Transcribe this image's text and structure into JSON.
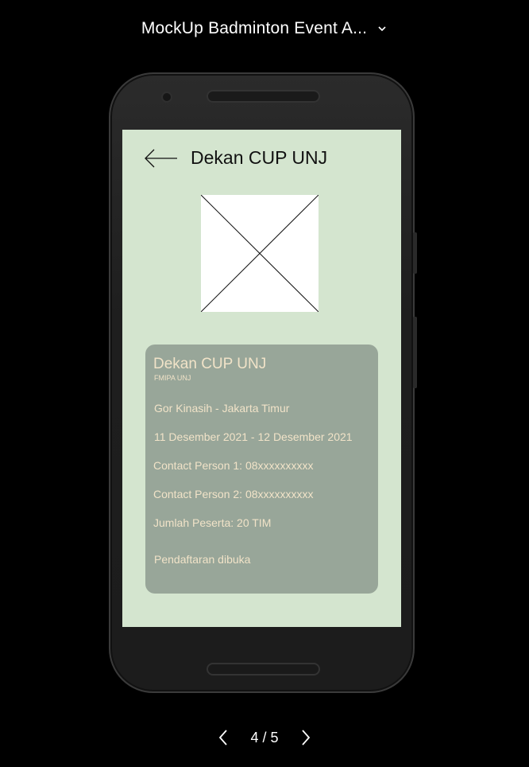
{
  "header": {
    "title": "MockUp Badminton Event A...",
    "dropdown_icon": "chevron-down-icon"
  },
  "screen": {
    "back_icon": "arrow-left-icon",
    "title": "Dekan CUP UNJ",
    "image_placeholder": "image-placeholder"
  },
  "card": {
    "title": "Dekan CUP UNJ",
    "organizer": "FMIPA UNJ",
    "location": "Gor Kinasih - Jakarta Timur",
    "dates": "11 Desember 2021 - 12 Desember 2021",
    "contact1": "Contact Person 1: 08xxxxxxxxxx",
    "contact2": "Contact Person 2: 08xxxxxxxxxx",
    "participants": "Jumlah Peserta: 20 TIM",
    "status": "Pendaftaran dibuka"
  },
  "pager": {
    "label": "4 / 5",
    "prev_icon": "chevron-left-icon",
    "next_icon": "chevron-right-icon"
  },
  "colors": {
    "background": "#000000",
    "screen_bg": "#d4e5cf",
    "card_bg": "#98a699",
    "card_text": "#f1e3c8"
  }
}
